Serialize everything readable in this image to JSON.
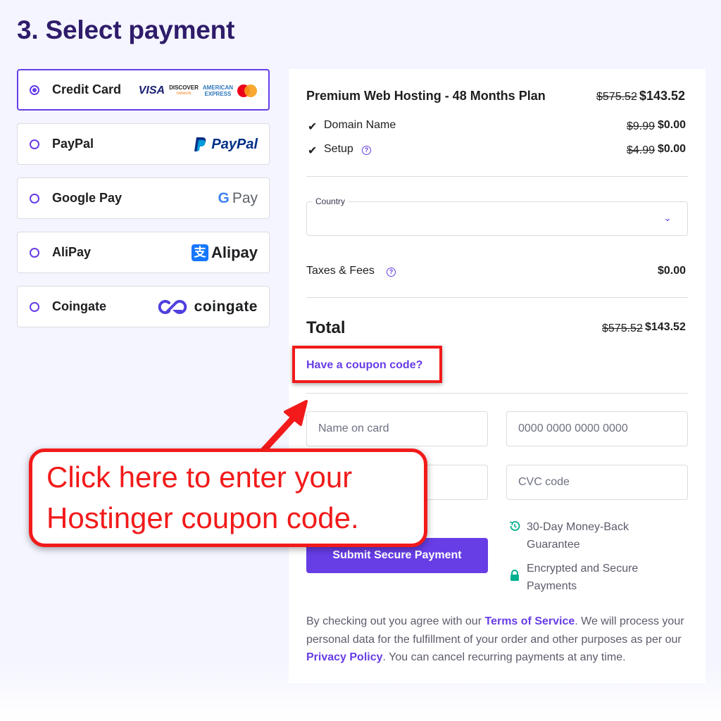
{
  "page": {
    "title": "3. Select payment"
  },
  "payment_methods": [
    {
      "label": "Credit Card",
      "selected": true,
      "logos": [
        "VISA",
        "DISCOVER",
        "network",
        "AMERICAN",
        "EXPRESS",
        "mastercard-icon"
      ]
    },
    {
      "label": "PayPal",
      "selected": false,
      "logo_text": "PayPal"
    },
    {
      "label": "Google Pay",
      "selected": false,
      "logo_text": "Pay"
    },
    {
      "label": "AliPay",
      "selected": false,
      "logo_text": "Alipay"
    },
    {
      "label": "Coingate",
      "selected": false,
      "logo_text": "coingate"
    }
  ],
  "summary": {
    "plan": {
      "name": "Premium Web Hosting - 48 Months Plan",
      "old_price": "$575.52",
      "price": "$143.52"
    },
    "items": [
      {
        "name": "Domain Name",
        "old_price": "$9.99",
        "price": "$0.00",
        "help": false
      },
      {
        "name": "Setup",
        "old_price": "$4.99",
        "price": "$0.00",
        "help": true
      }
    ],
    "country_label": "Country",
    "taxes": {
      "label": "Taxes & Fees",
      "price": "$0.00"
    },
    "total": {
      "label": "Total",
      "old_price": "$575.52",
      "price": "$143.52"
    },
    "coupon_link": "Have a coupon code?"
  },
  "form": {
    "name_placeholder": "Name on card",
    "card_placeholder": "0000 0000 0000 0000",
    "cvc_placeholder": "CVC code",
    "submit_label": "Submit Secure Payment"
  },
  "features": [
    {
      "text": "30-Day Money-Back Guarantee",
      "icon": "history-icon"
    },
    {
      "text": "Encrypted and Secure Payments",
      "icon": "lock-icon"
    }
  ],
  "legal": {
    "part1": "By checking out you agree with our ",
    "terms": "Terms of Service",
    "part2": ". We will process your personal data for the fulfillment of your order and other purposes as per our ",
    "privacy": "Privacy Policy",
    "part3": ". You can cancel recurring payments at any time."
  },
  "annotation": {
    "line1": "Click here to enter your",
    "line2": "Hostinger coupon code."
  },
  "colors": {
    "brand": "#673de6",
    "heading": "#2f1c6a",
    "annotation": "#f21a1a",
    "check": "#00b090"
  }
}
